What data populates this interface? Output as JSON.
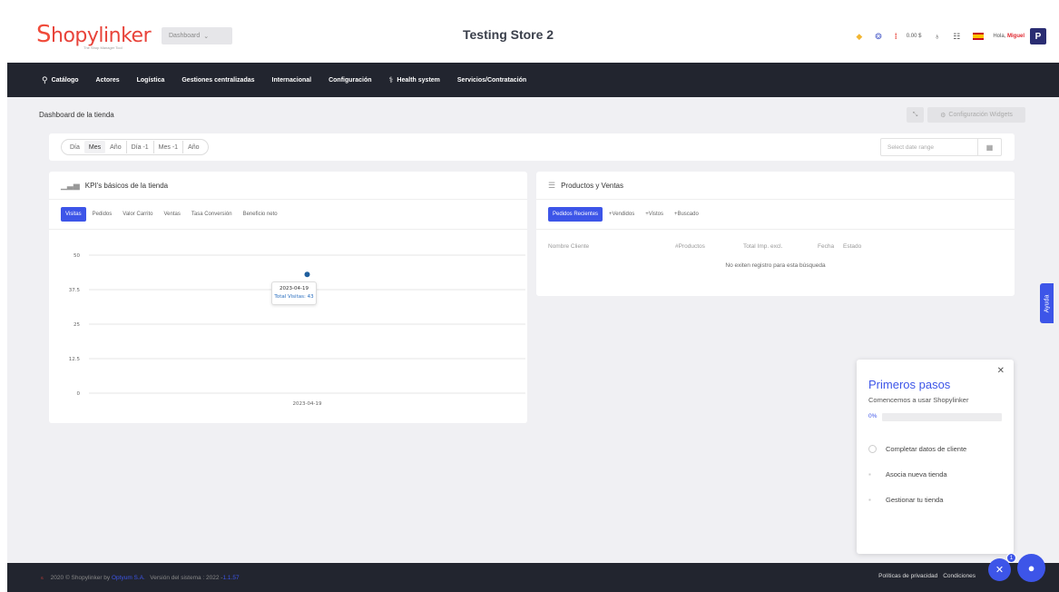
{
  "header": {
    "logo_s": "S",
    "logo_rest": "hopylinker",
    "logo_tagline": "The Shop Manager Tool",
    "dashboard_select": "Dashboard",
    "store_title": "Testing Store 2",
    "balance": "0.00 $",
    "greeting": "Hola, ",
    "user_name": "Miguel",
    "avatar_letter": "P"
  },
  "nav": {
    "items": [
      {
        "label": "Catálogo",
        "icon": "catalog-icon"
      },
      {
        "label": "Actores"
      },
      {
        "label": "Logística"
      },
      {
        "label": "Gestiones centralizadas"
      },
      {
        "label": "Internacional"
      },
      {
        "label": "Configuración"
      },
      {
        "label": "Health system",
        "icon": "health-icon"
      },
      {
        "label": "Servicios/Contratación"
      }
    ]
  },
  "page": {
    "title": "Dashboard de la tienda",
    "widgets_button": "Configuración Widgets"
  },
  "datebar": {
    "ranges": [
      "Día",
      "Mes",
      "Año",
      "Día -1",
      "Mes -1",
      "Año"
    ],
    "active_range": "Mes",
    "date_placeholder": "Select date range"
  },
  "kpi": {
    "title": "KPI's básicos de la tienda",
    "tabs": [
      "Visitas",
      "Pedidos",
      "Valor Carrito",
      "Ventas",
      "Tasa Conversión",
      "Beneficio neto"
    ],
    "active_tab": "Visitas"
  },
  "chart_data": {
    "type": "scatter",
    "x": [
      "2023-04-19"
    ],
    "y": [
      43
    ],
    "y_ticks": [
      "50",
      "37.5",
      "25",
      "12.5",
      "0"
    ],
    "x_tick_labels": [
      "2023-04-19"
    ],
    "ylim": [
      0,
      50
    ],
    "grid": true,
    "series_color": "#1f5f9e",
    "tooltip": {
      "date": "2023-04-19",
      "label": "Total Visitas: 43"
    }
  },
  "products": {
    "title": "Productos y Ventas",
    "tabs": [
      "Pedidos Recientes",
      "+Vendidos",
      "+Vistos",
      "+Buscado"
    ],
    "active_tab": "Pedidos Recientes",
    "columns": [
      "Nombre Cliente",
      "#Productos",
      "Total Imp. excl.",
      "Fecha",
      "Estado"
    ],
    "empty_message": "No exiten registro para esta búsqueda"
  },
  "help": {
    "label": "Ayuda"
  },
  "onboarding": {
    "title": "Primeros pasos",
    "subtitle": "Comencemos a usar Shopylinker",
    "progress_label": "0%",
    "progress": 0,
    "steps": [
      "Completar datos de cliente",
      "Asocia nueva tienda",
      "Gestionar tu tienda"
    ]
  },
  "footer": {
    "copyright": "2020 © Shopylinker by ",
    "company": "Optyum S.A.",
    "version_label": "Versión del sistema : 2022 -",
    "version": "1.1.57",
    "privacy": "Políticas de privacidad",
    "conditions": "Condiciones",
    "badge": "1"
  },
  "colors": {
    "accent": "#3d55e8",
    "nav_bg": "#22252f",
    "brand_red": "#e8433a"
  }
}
